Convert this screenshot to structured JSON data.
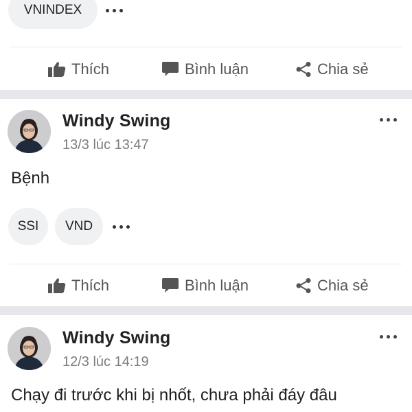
{
  "top_post": {
    "tags": [
      "VNINDEX"
    ]
  },
  "actions": {
    "like": "Thích",
    "comment": "Bình luận",
    "share": "Chia sẻ"
  },
  "posts": [
    {
      "author": "Windy Swing",
      "time": "13/3 lúc 13:47",
      "body": "Bệnh",
      "tags": [
        "SSI",
        "VND"
      ]
    },
    {
      "author": "Windy Swing",
      "time": "12/3 lúc 14:19",
      "body": "Chạy đi trước khi bị nhốt, chưa phải đáy đâu"
    }
  ],
  "colors": {
    "separator": "#e6e7ea",
    "tag_bg": "#f0f1f3",
    "action_text": "#555555",
    "time_text": "#7d7d7d"
  }
}
